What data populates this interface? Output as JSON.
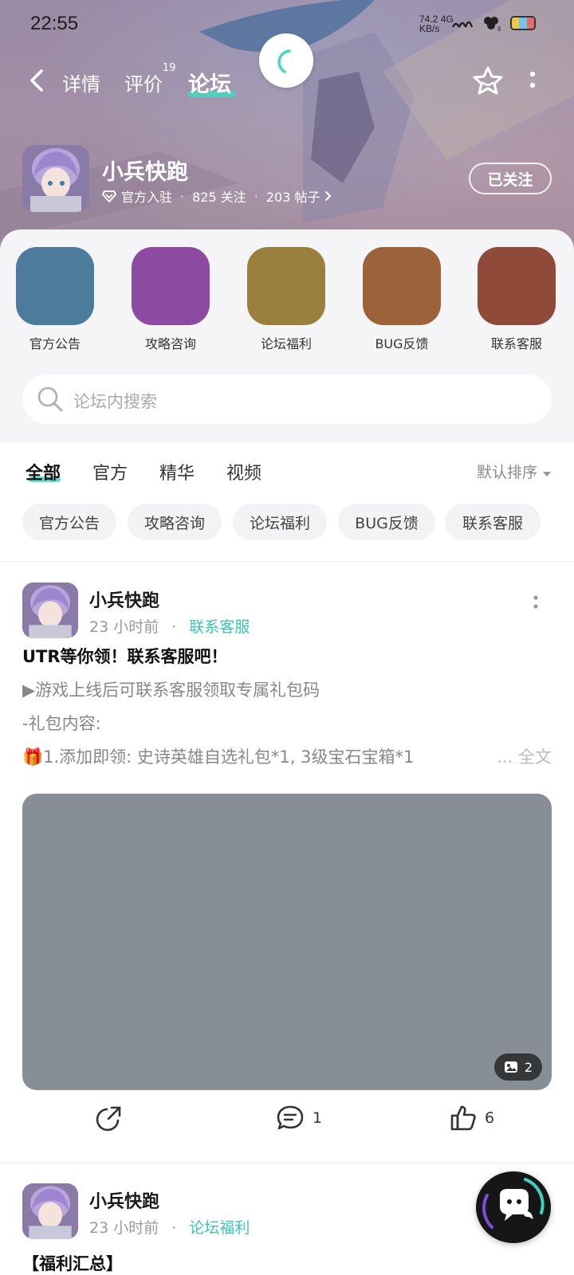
{
  "status_bar": {
    "time": "22:55",
    "net_speed": "74.2",
    "net_unit": "KB/s",
    "net_type": "4G",
    "battery_colors": [
      "#f4c542",
      "#6ec6e8",
      "#e86c6c"
    ]
  },
  "nav": {
    "tabs": [
      {
        "label": "详情"
      },
      {
        "label": "评价",
        "badge": "19"
      },
      {
        "label": "论坛"
      }
    ],
    "active_tab": "论坛"
  },
  "game": {
    "title": "小兵快跑",
    "official": "官方入驻",
    "followers": "825 关注",
    "posts": "203 帖子",
    "follow_label": "已关注"
  },
  "categories": [
    {
      "label": "官方公告",
      "color": "#4c7b9c"
    },
    {
      "label": "攻略咨询",
      "color": "#8c4aa0"
    },
    {
      "label": "论坛福利",
      "color": "#9a7f3e"
    },
    {
      "label": "BUG反馈",
      "color": "#9c633a"
    },
    {
      "label": "联系客服",
      "color": "#8f4a39"
    }
  ],
  "search": {
    "placeholder": "论坛内搜索"
  },
  "filter_tabs": [
    "全部",
    "官方",
    "精华",
    "视频"
  ],
  "sort_label": "默认排序",
  "chips": [
    "官方公告",
    "攻略咨询",
    "论坛福利",
    "BUG反馈",
    "联系客服"
  ],
  "posts": [
    {
      "author": "小兵快跑",
      "time": "23 小时前",
      "tag": "联系客服",
      "title": "UTR等你领！联系客服吧！",
      "lines": [
        "▶游戏上线后可联系客服领取专属礼包码",
        "-礼包内容:",
        "🎁1.添加即领: 史诗英雄自选礼包*1, 3级宝石宝箱*1"
      ],
      "ellipsis": "...",
      "fulltext": "全文",
      "image_count": "2",
      "comments": "1",
      "likes": "6"
    },
    {
      "author": "小兵快跑",
      "time": "23 小时前",
      "tag": "论坛福利",
      "title": "【福利汇总】"
    }
  ],
  "colors": {
    "accent": "#46d6c3",
    "tag_text": "#3cc3b1"
  }
}
